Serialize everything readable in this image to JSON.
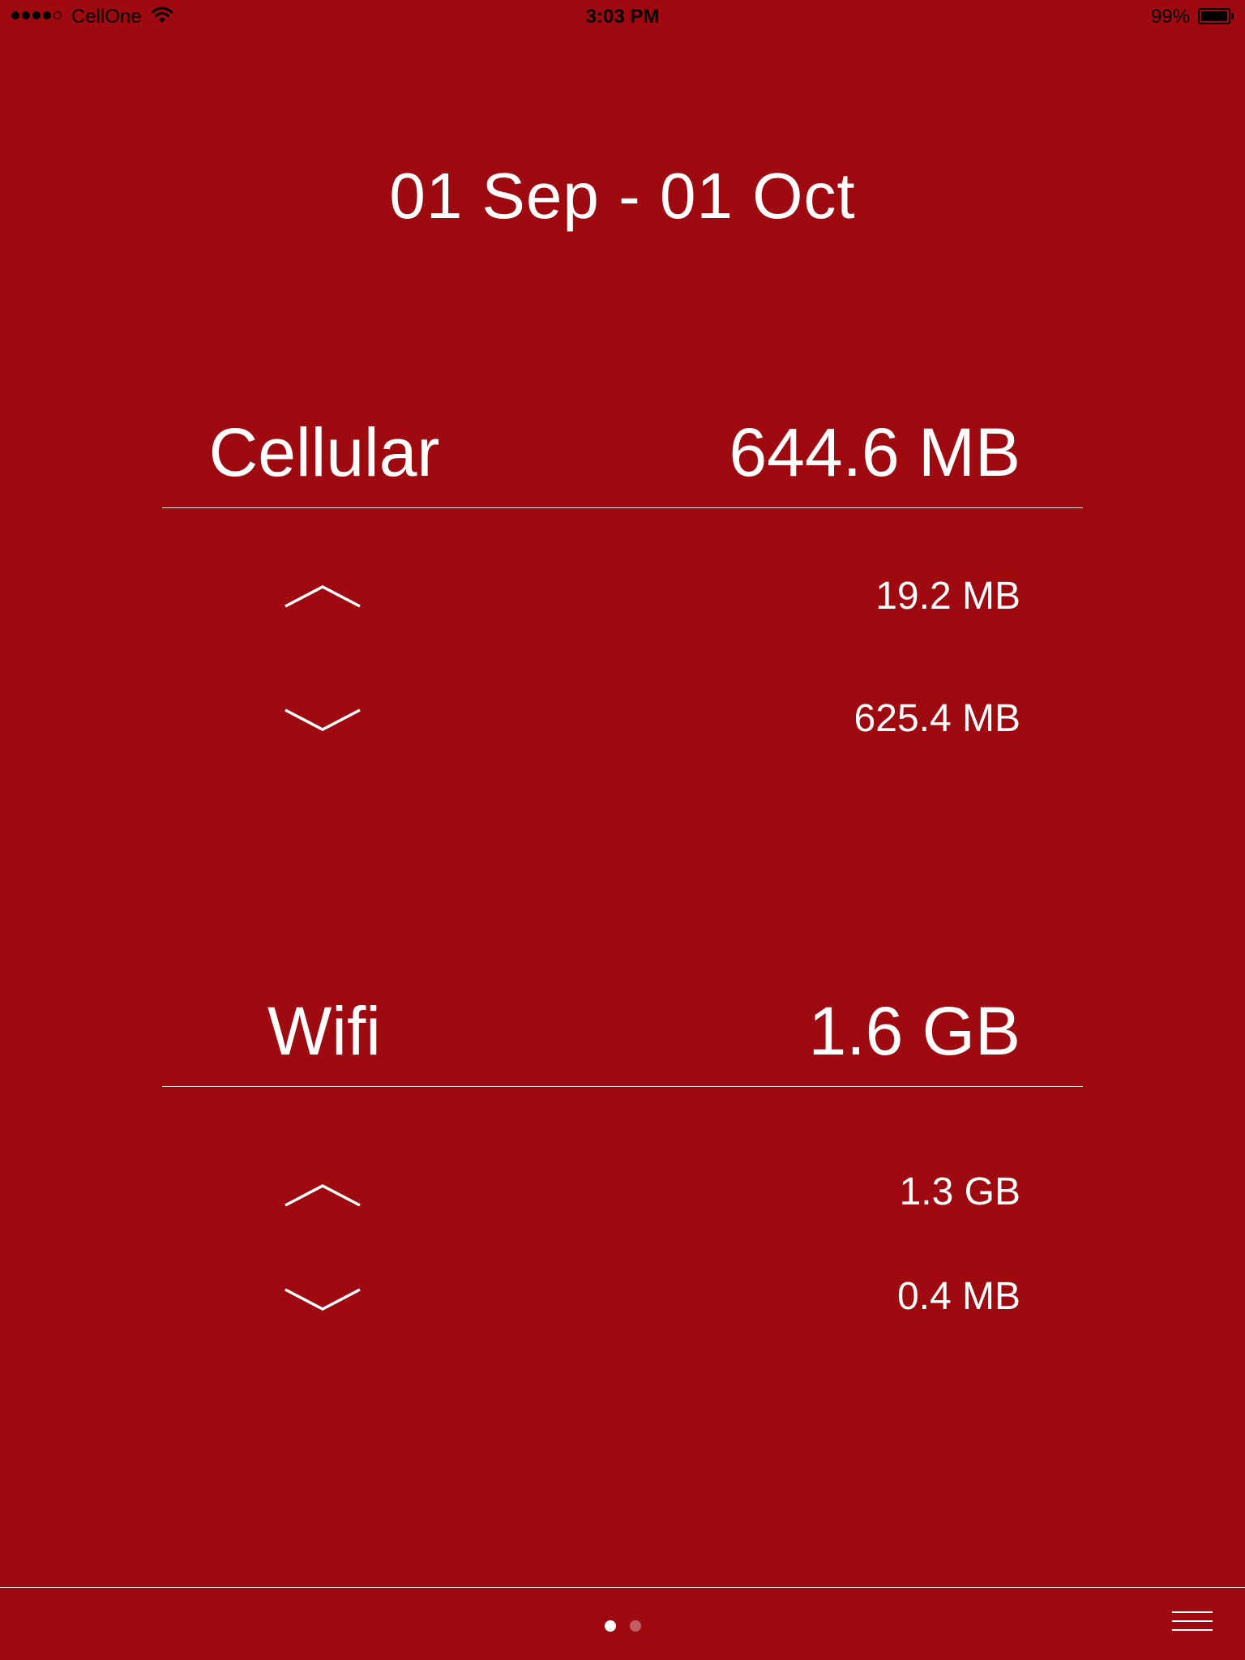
{
  "status_bar": {
    "carrier": "CellOne",
    "time": "3:03 PM",
    "battery": "99%",
    "battery_level": 0.99,
    "signal_bars": 4,
    "signal_total": 5
  },
  "header": {
    "date_range": "01 Sep - 01 Oct"
  },
  "cellular": {
    "title": "Cellular",
    "total": "644.6 MB",
    "upload": "19.2 MB",
    "download": "625.4 MB"
  },
  "wifi": {
    "title": "Wifi",
    "total": "1.6 GB",
    "upload": "1.3 GB",
    "download": "0.4 MB"
  },
  "pager": {
    "pages": 2,
    "current": 1
  },
  "colors": {
    "background": "#9e0a10",
    "foreground": "#ffffff"
  },
  "icons": {
    "upload": "chevron-up-icon",
    "download": "chevron-down-icon",
    "menu": "hamburger-menu-icon",
    "wifi": "wifi-icon",
    "battery": "battery-icon"
  }
}
